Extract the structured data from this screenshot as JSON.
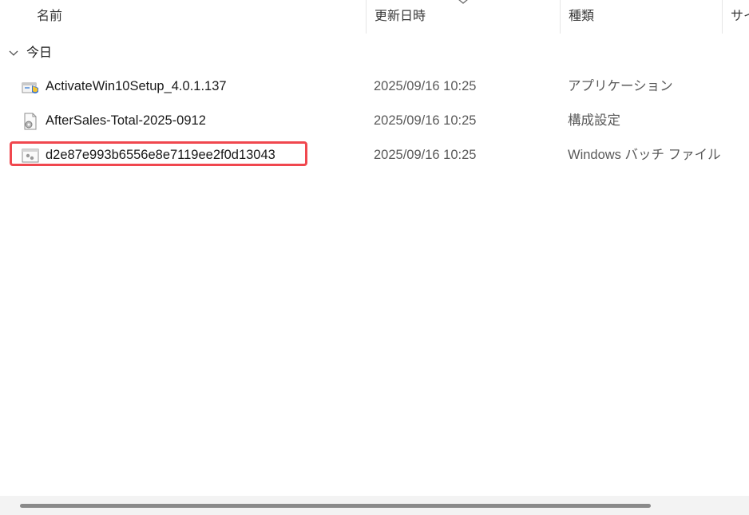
{
  "columns": {
    "name": "名前",
    "date_modified": "更新日時",
    "type": "種類",
    "size": "サイ"
  },
  "sort": {
    "column": "更新日時",
    "direction": "descending",
    "icon": "chevron-down-icon"
  },
  "group": {
    "label": "今日",
    "expanded": true
  },
  "files": [
    {
      "name": "ActivateWin10Setup_4.0.1.137",
      "date": "2025/09/16 10:25",
      "type": "アプリケーション",
      "icon": "application-installer-icon"
    },
    {
      "name": "AfterSales-Total-2025-0912",
      "date": "2025/09/16 10:25",
      "type": "構成設定",
      "icon": "config-settings-file-icon"
    },
    {
      "name": "d2e87e993b6556e8e7119ee2f0d13043",
      "date": "2025/09/16 10:25",
      "type": "Windows バッチ ファイル",
      "icon": "batch-file-icon",
      "highlighted": true
    }
  ],
  "colors": {
    "highlight_border": "#f0474e",
    "header_text": "#3a3a3a",
    "secondary_text": "#5a5a5a",
    "scrollbar_thumb": "#8a8a8a"
  }
}
